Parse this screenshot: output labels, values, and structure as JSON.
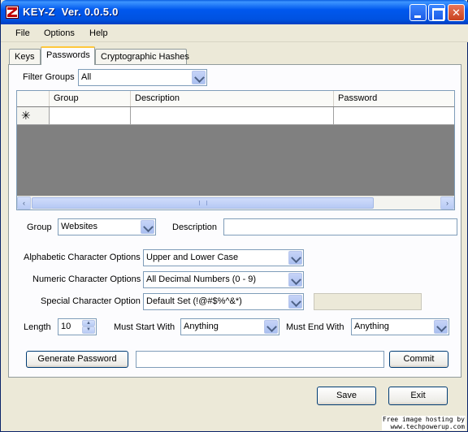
{
  "window": {
    "title": "KEY-Z  Ver. 0.0.5.0",
    "controls": {
      "minimize": "",
      "maximize": "",
      "close": "✕"
    }
  },
  "menu": {
    "items": [
      "File",
      "Options",
      "Help"
    ]
  },
  "tabs": [
    {
      "label": "Keys",
      "active": false
    },
    {
      "label": "Passwords",
      "active": true
    },
    {
      "label": "Cryptographic Hashes",
      "active": false
    }
  ],
  "filter": {
    "label": "Filter Groups",
    "value": "All"
  },
  "grid": {
    "columns": [
      "Group",
      "Description",
      "Password"
    ],
    "new_row_marker": "✳",
    "scroll_left": "‹",
    "scroll_right": "›"
  },
  "form": {
    "group_label": "Group",
    "group_value": "Websites",
    "description_label": "Description",
    "description_value": "",
    "alphabetic_label": "Alphabetic Character Options",
    "alphabetic_value": "Upper and Lower Case",
    "numeric_label": "Numeric Character Options",
    "numeric_value": "All Decimal Numbers (0 - 9)",
    "special_label": "Special Character Option",
    "special_value": "Default Set (!@#$%^&*)",
    "special_custom_value": "",
    "length_label": "Length",
    "length_value": "10",
    "start_label": "Must Start With",
    "start_value": "Anything",
    "end_label": "Must End With",
    "end_value": "Anything",
    "generate_label": "Generate Password",
    "generated_value": "",
    "commit_label": "Commit"
  },
  "footer": {
    "save_label": "Save",
    "exit_label": "Exit"
  },
  "watermark": {
    "line1": "Free image hosting by",
    "line2": "www.techpowerup.com"
  }
}
